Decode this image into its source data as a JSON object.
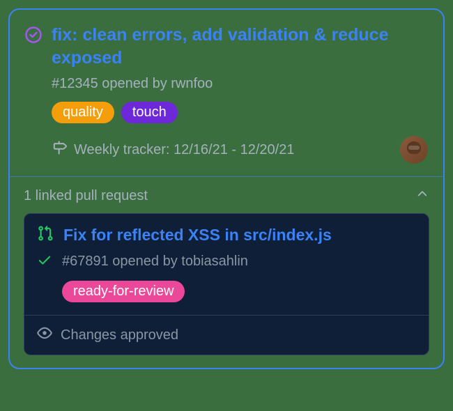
{
  "issue": {
    "title": "fix: clean errors, add validation & reduce exposed",
    "meta": "#12345 opened by rwnfoo",
    "labels": {
      "quality": "quality",
      "touch": "touch"
    },
    "milestone": "Weekly tracker: 12/16/21 - 12/20/21"
  },
  "linked": {
    "header": "1 linked pull request"
  },
  "pr": {
    "title": "Fix for reflected XSS in src/index.js",
    "meta": "#67891 opened by tobiasahlin",
    "labels": {
      "ready": "ready-for-review"
    },
    "footer": "Changes approved"
  }
}
